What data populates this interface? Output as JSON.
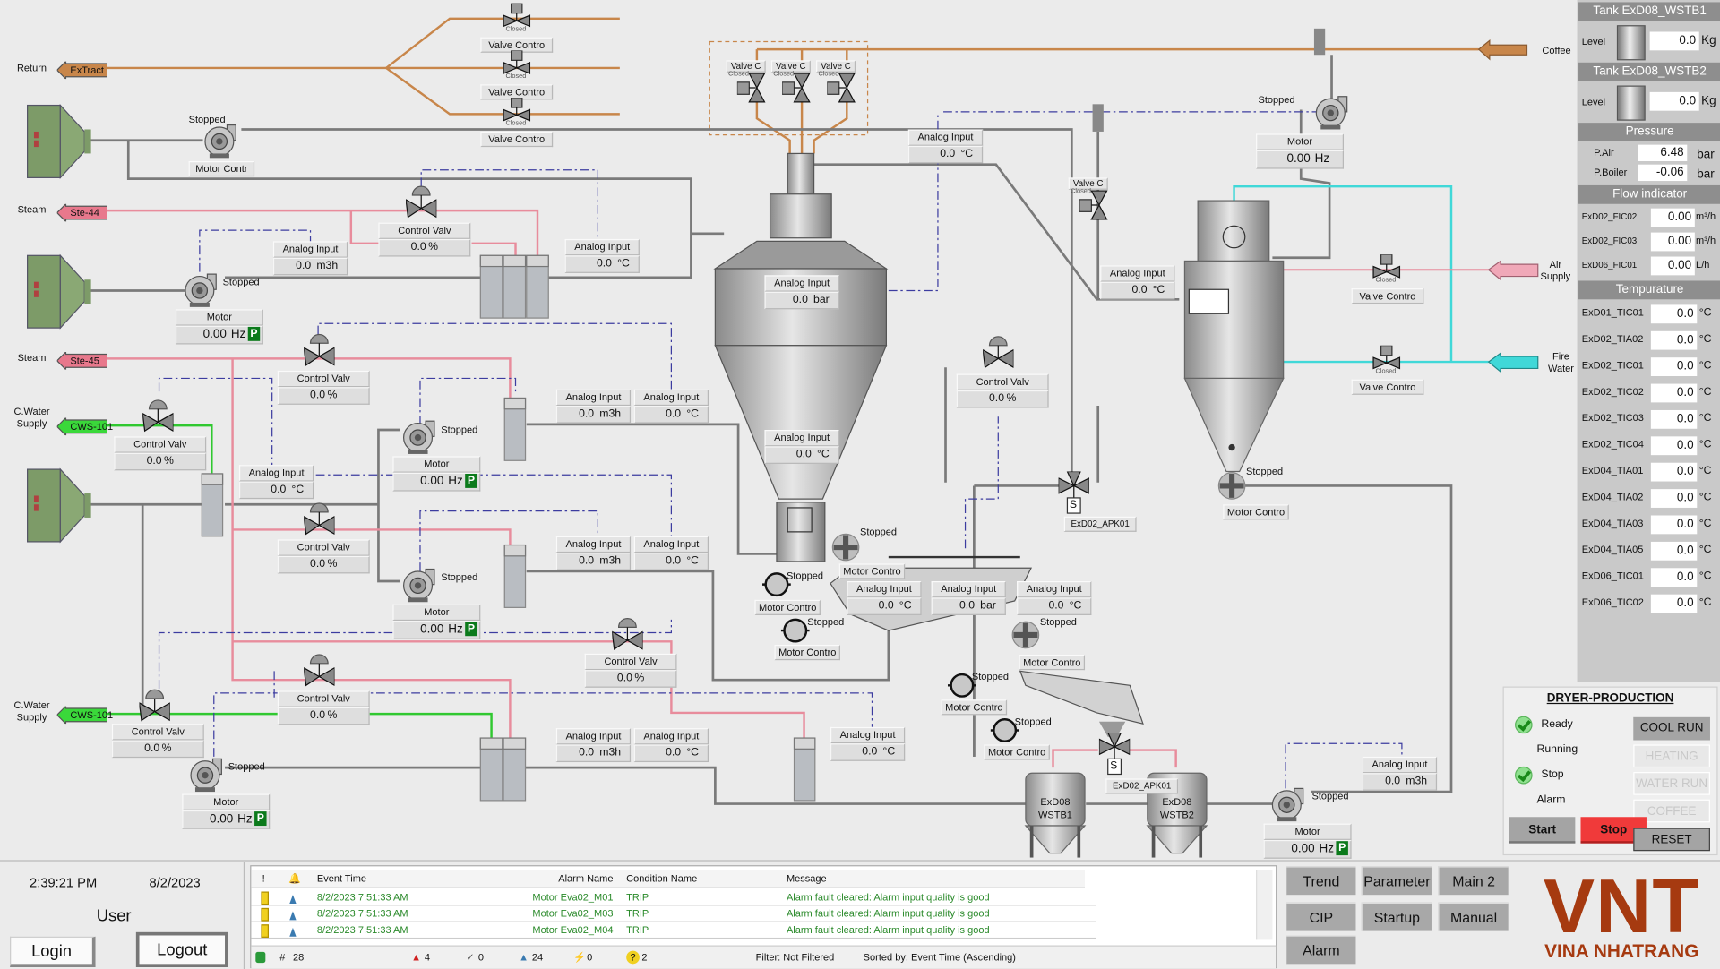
{
  "colors": {
    "process": "#7a7a7a",
    "steam": "#e88c9c",
    "coffee": "#c8864a",
    "cooling_water": "#30c830",
    "fire_water": "#40d8d8",
    "signal": "#3c3ca0",
    "brand": "#a63a10",
    "stop": "#f03a3a"
  },
  "sources": [
    {
      "label": "Return",
      "tag": "ExTract",
      "color": "#c8864a"
    },
    {
      "label": "Steam",
      "tag": "Ste-44",
      "color": "#e8788c"
    },
    {
      "label": "Steam",
      "tag": "Ste-45",
      "color": "#e8788c"
    },
    {
      "label": "C.Water Supply",
      "tag": "CWS-101",
      "color": "#3ad83a"
    },
    {
      "label": "C.Water Supply",
      "tag": "CWS-101",
      "color": "#3ad83a"
    }
  ],
  "outputs": [
    {
      "label": "Coffee"
    },
    {
      "label": "Air Supply"
    },
    {
      "label": "Fire Water"
    }
  ],
  "analog_inputs": [
    {
      "label": "Analog Input",
      "value": "0.0",
      "unit": "m3h"
    },
    {
      "label": "Analog Input",
      "value": "0.0",
      "unit": "°C"
    },
    {
      "label": "Analog Input",
      "value": "0.0",
      "unit": "°C"
    },
    {
      "label": "Analog Input",
      "value": "0.0",
      "unit": "bar"
    },
    {
      "label": "Analog Input",
      "value": "0.0",
      "unit": "m3h"
    },
    {
      "label": "Analog Input",
      "value": "0.0",
      "unit": "°C"
    },
    {
      "label": "Analog Input",
      "value": "0.0",
      "unit": "°C"
    },
    {
      "label": "Analog Input",
      "value": "0.0",
      "unit": "°C"
    },
    {
      "label": "Analog Input",
      "value": "0.0",
      "unit": "m3h"
    },
    {
      "label": "Analog Input",
      "value": "0.0",
      "unit": "°C"
    },
    {
      "label": "Analog Input",
      "value": "0.0",
      "unit": "°C"
    },
    {
      "label": "Analog Input",
      "value": "0.0",
      "unit": "°C"
    },
    {
      "label": "Analog Input",
      "value": "0.0",
      "unit": "bar"
    },
    {
      "label": "Analog Input",
      "value": "0.0",
      "unit": "°C"
    },
    {
      "label": "Analog Input",
      "value": "0.0",
      "unit": "m3h"
    },
    {
      "label": "Analog Input",
      "value": "0.0",
      "unit": "°C"
    },
    {
      "label": "Analog Input",
      "value": "0.0",
      "unit": "°C"
    },
    {
      "label": "Analog Input",
      "value": "0.0",
      "unit": "m3h"
    }
  ],
  "motors": [
    {
      "label": "Motor",
      "value": "0.00",
      "unit": "Hz",
      "status": "Stopped",
      "badge": "P"
    },
    {
      "label": "Motor",
      "value": "0.00",
      "unit": "Hz",
      "status": "Stopped",
      "badge": "P"
    },
    {
      "label": "Motor",
      "value": "0.00",
      "unit": "Hz",
      "status": "Stopped",
      "badge": "P"
    },
    {
      "label": "Motor",
      "value": "0.00",
      "unit": "Hz",
      "status": "Stopped",
      "badge": "P"
    },
    {
      "label": "Motor",
      "value": "0.00",
      "unit": "Hz",
      "status": "Stopped",
      "badge": ""
    },
    {
      "label": "Motor",
      "value": "0.00",
      "unit": "Hz",
      "status": "Stopped",
      "badge": "P"
    }
  ],
  "motor_controls": [
    {
      "label": "Motor Contr",
      "status": "Stopped"
    },
    {
      "label": "Motor Contro",
      "status": "Stopped"
    },
    {
      "label": "Motor Contro",
      "status": "Stopped"
    },
    {
      "label": "Motor Contro",
      "status": "Stopped"
    },
    {
      "label": "Motor Contro",
      "status": "Stopped"
    },
    {
      "label": "Motor Contro",
      "status": "Stopped"
    },
    {
      "label": "Motor Contro",
      "status": "Stopped"
    },
    {
      "label": "Motor Contro",
      "status": "Stopped"
    }
  ],
  "control_valves": [
    {
      "label": "Control Valv",
      "value": "0.0",
      "unit": "%"
    },
    {
      "label": "Control Valv",
      "value": "0.0",
      "unit": "%"
    },
    {
      "label": "Control Valv",
      "value": "0.0",
      "unit": "%"
    },
    {
      "label": "Control Valv",
      "value": "0.0",
      "unit": "%"
    },
    {
      "label": "Control Valv",
      "value": "0.0",
      "unit": "%"
    },
    {
      "label": "Control Valv",
      "value": "0.0",
      "unit": "%"
    },
    {
      "label": "Control Valv",
      "value": "0.0",
      "unit": "%"
    },
    {
      "label": "Control Valv",
      "value": "0.0",
      "unit": "%"
    }
  ],
  "valve_controls": [
    {
      "label": "Valve Contro",
      "state": "Closed",
      "solenoid": "S"
    },
    {
      "label": "Valve Contro",
      "state": "Closed",
      "solenoid": "S"
    },
    {
      "label": "Valve Contro",
      "state": "Closed",
      "solenoid": "S"
    },
    {
      "label": "Valve Contro",
      "state": "Closed",
      "solenoid": "S"
    },
    {
      "label": "Valve Contro",
      "state": "Closed",
      "solenoid": "S"
    }
  ],
  "small_valves": [
    {
      "label": "Valve C",
      "state": "Closed",
      "solenoid": "S"
    },
    {
      "label": "Valve C",
      "state": "Closed",
      "solenoid": "S"
    },
    {
      "label": "Valve C",
      "state": "Closed",
      "solenoid": "S"
    },
    {
      "label": "Valve C",
      "state": "Closed",
      "solenoid": "S"
    }
  ],
  "diverters": [
    {
      "label": "ExD02_APK01",
      "solenoid": "S"
    },
    {
      "label": "ExD02_APK01",
      "solenoid": "S"
    }
  ],
  "tanks": [
    {
      "line1": "ExD08",
      "line2": "WSTB1"
    },
    {
      "line1": "ExD08",
      "line2": "WSTB2"
    }
  ],
  "side_panel": {
    "tanks": [
      {
        "title": "Tank ExD08_WSTB1",
        "label": "Level",
        "value": "0.0",
        "unit": "Kg"
      },
      {
        "title": "Tank ExD08_WSTB2",
        "label": "Level",
        "value": "0.0",
        "unit": "Kg"
      }
    ],
    "pressure": {
      "title": "Pressure",
      "rows": [
        {
          "name": "P.Air",
          "value": "6.48",
          "unit": "bar"
        },
        {
          "name": "P.Boiler",
          "value": "-0.06",
          "unit": "bar"
        }
      ]
    },
    "flow": {
      "title": "Flow indicator",
      "rows": [
        {
          "name": "ExD02_FIC02",
          "value": "0.00",
          "unit": "m³/h"
        },
        {
          "name": "ExD02_FIC03",
          "value": "0.00",
          "unit": "m³/h"
        },
        {
          "name": "ExD06_FIC01",
          "value": "0.00",
          "unit": "L/h"
        }
      ]
    },
    "temperature": {
      "title": "Tempurature",
      "rows": [
        {
          "name": "ExD01_TIC01",
          "value": "0.0",
          "unit": "°C"
        },
        {
          "name": "ExD02_TIA02",
          "value": "0.0",
          "unit": "°C"
        },
        {
          "name": "ExD02_TIC01",
          "value": "0.0",
          "unit": "°C"
        },
        {
          "name": "ExD02_TIC02",
          "value": "0.0",
          "unit": "°C"
        },
        {
          "name": "ExD02_TIC03",
          "value": "0.0",
          "unit": "°C"
        },
        {
          "name": "ExD02_TIC04",
          "value": "0.0",
          "unit": "°C"
        },
        {
          "name": "ExD04_TIA01",
          "value": "0.0",
          "unit": "°C"
        },
        {
          "name": "ExD04_TIA02",
          "value": "0.0",
          "unit": "°C"
        },
        {
          "name": "ExD04_TIA03",
          "value": "0.0",
          "unit": "°C"
        },
        {
          "name": "ExD04_TIA05",
          "value": "0.0",
          "unit": "°C"
        },
        {
          "name": "ExD06_TIC01",
          "value": "0.0",
          "unit": "°C"
        },
        {
          "name": "ExD06_TIC02",
          "value": "0.0",
          "unit": "°C"
        }
      ]
    }
  },
  "dryer": {
    "title": "DRYER-PRODUCTION",
    "status": [
      {
        "label": "Ready",
        "checked": true
      },
      {
        "label": "Running",
        "checked": false
      },
      {
        "label": "Stop",
        "checked": true
      },
      {
        "label": "Alarm",
        "checked": false
      }
    ],
    "modes": [
      {
        "label": "COOL RUN",
        "enabled": true
      },
      {
        "label": "HEATING",
        "enabled": false
      },
      {
        "label": "WATER RUN",
        "enabled": false
      },
      {
        "label": "COFFEE RUN",
        "enabled": false
      }
    ],
    "start": "Start",
    "stop": "Stop",
    "reset": "RESET"
  },
  "footer": {
    "time": "2:39:21 PM",
    "date": "8/2/2023",
    "user": "User",
    "login": "Login",
    "logout": "Logout"
  },
  "alarms": {
    "columns": [
      "!",
      "",
      "Event Time",
      "Alarm Name",
      "Condition Name",
      "Message"
    ],
    "rows": [
      {
        "time": "8/2/2023 7:51:33 AM",
        "name": "Motor Eva02_M01",
        "condition": "TRIP",
        "message": "Alarm fault cleared: Alarm input quality is good"
      },
      {
        "time": "8/2/2023 7:51:33 AM",
        "name": "Motor Eva02_M03",
        "condition": "TRIP",
        "message": "Alarm fault cleared: Alarm input quality is good"
      },
      {
        "time": "8/2/2023 7:51:33 AM",
        "name": "Motor Eva02_M04",
        "condition": "TRIP",
        "message": "Alarm fault cleared: Alarm input quality is good"
      }
    ],
    "status": {
      "total": "28",
      "active": "4",
      "acked": "0",
      "unacked": "24",
      "shelved": "0",
      "unknown": "2",
      "filter": "Filter: Not Filtered",
      "sort": "Sorted by: Event Time (Ascending)"
    }
  },
  "nav": [
    {
      "label": "Trend"
    },
    {
      "label": "Parameter"
    },
    {
      "label": "Main 2"
    },
    {
      "label": "CIP"
    },
    {
      "label": "Startup"
    },
    {
      "label": "Manual"
    },
    {
      "label": "Alarm"
    }
  ],
  "logo": {
    "big": "VNT",
    "small": "VINA NHATRANG"
  }
}
